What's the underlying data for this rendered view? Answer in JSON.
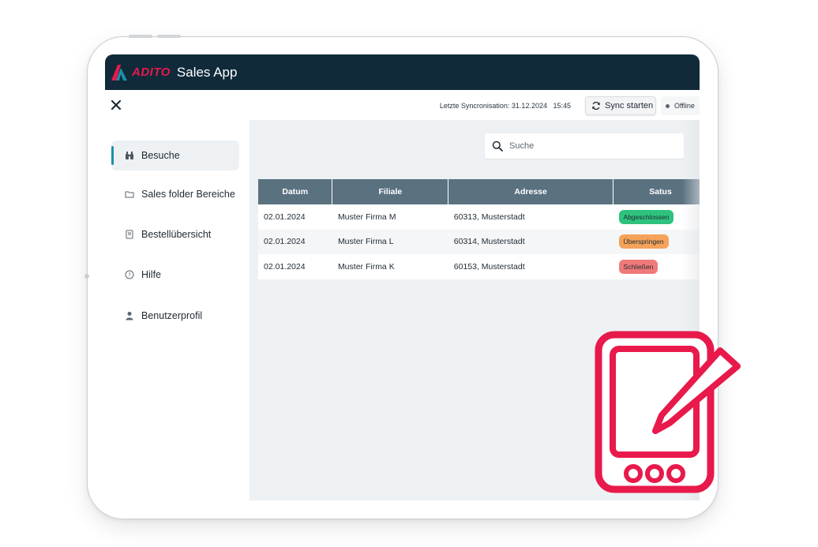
{
  "app": {
    "brand": "ADITO",
    "title": "Sales App",
    "brand_color": "#e8194b",
    "titlebar_color": "#102a3a"
  },
  "toolbar": {
    "close_icon": "close-icon",
    "sync_info": "Letzte Syncronisation: 31.12.2024   15:45",
    "sync_label": "Sync starten",
    "sync_icon": "refresh-icon",
    "status_label": "Offline"
  },
  "sidebar": {
    "accent_color": "#1e8fa8",
    "items": [
      {
        "label": "Besuche",
        "icon": "binoculars-icon",
        "active": true
      },
      {
        "label": "Sales folder Bereiche",
        "icon": "folder-icon",
        "active": false
      },
      {
        "label": "Bestellübersicht",
        "icon": "book-icon",
        "active": false
      },
      {
        "label": "Hilfe",
        "icon": "help-circle-icon",
        "active": false
      },
      {
        "label": "Benutzerprofil",
        "icon": "user-icon",
        "active": false
      }
    ]
  },
  "search": {
    "placeholder": "Suche",
    "icon": "search-icon"
  },
  "table": {
    "headers": [
      "Datum",
      "Filiale",
      "Adresse",
      "Satus"
    ],
    "header_color": "#5a7180",
    "rows": [
      {
        "datum": "02.01.2024",
        "filiale": "Muster Firma M",
        "adresse": "60313, Musterstadt",
        "status": "Abgeschlossen",
        "status_color": "#2ec27e"
      },
      {
        "datum": "02.01.2024",
        "filiale": "Muster Firma L",
        "adresse": "60314, Musterstadt",
        "status": "Überspringen",
        "status_color": "#f5a25a"
      },
      {
        "datum": "02.01.2024",
        "filiale": "Muster Firma K",
        "adresse": "60153, Musterstadt",
        "status": "Schließen",
        "status_color": "#ef7a7a"
      }
    ]
  },
  "decoration": {
    "icon": "tablet-pen-icon",
    "color": "#e8194b"
  }
}
